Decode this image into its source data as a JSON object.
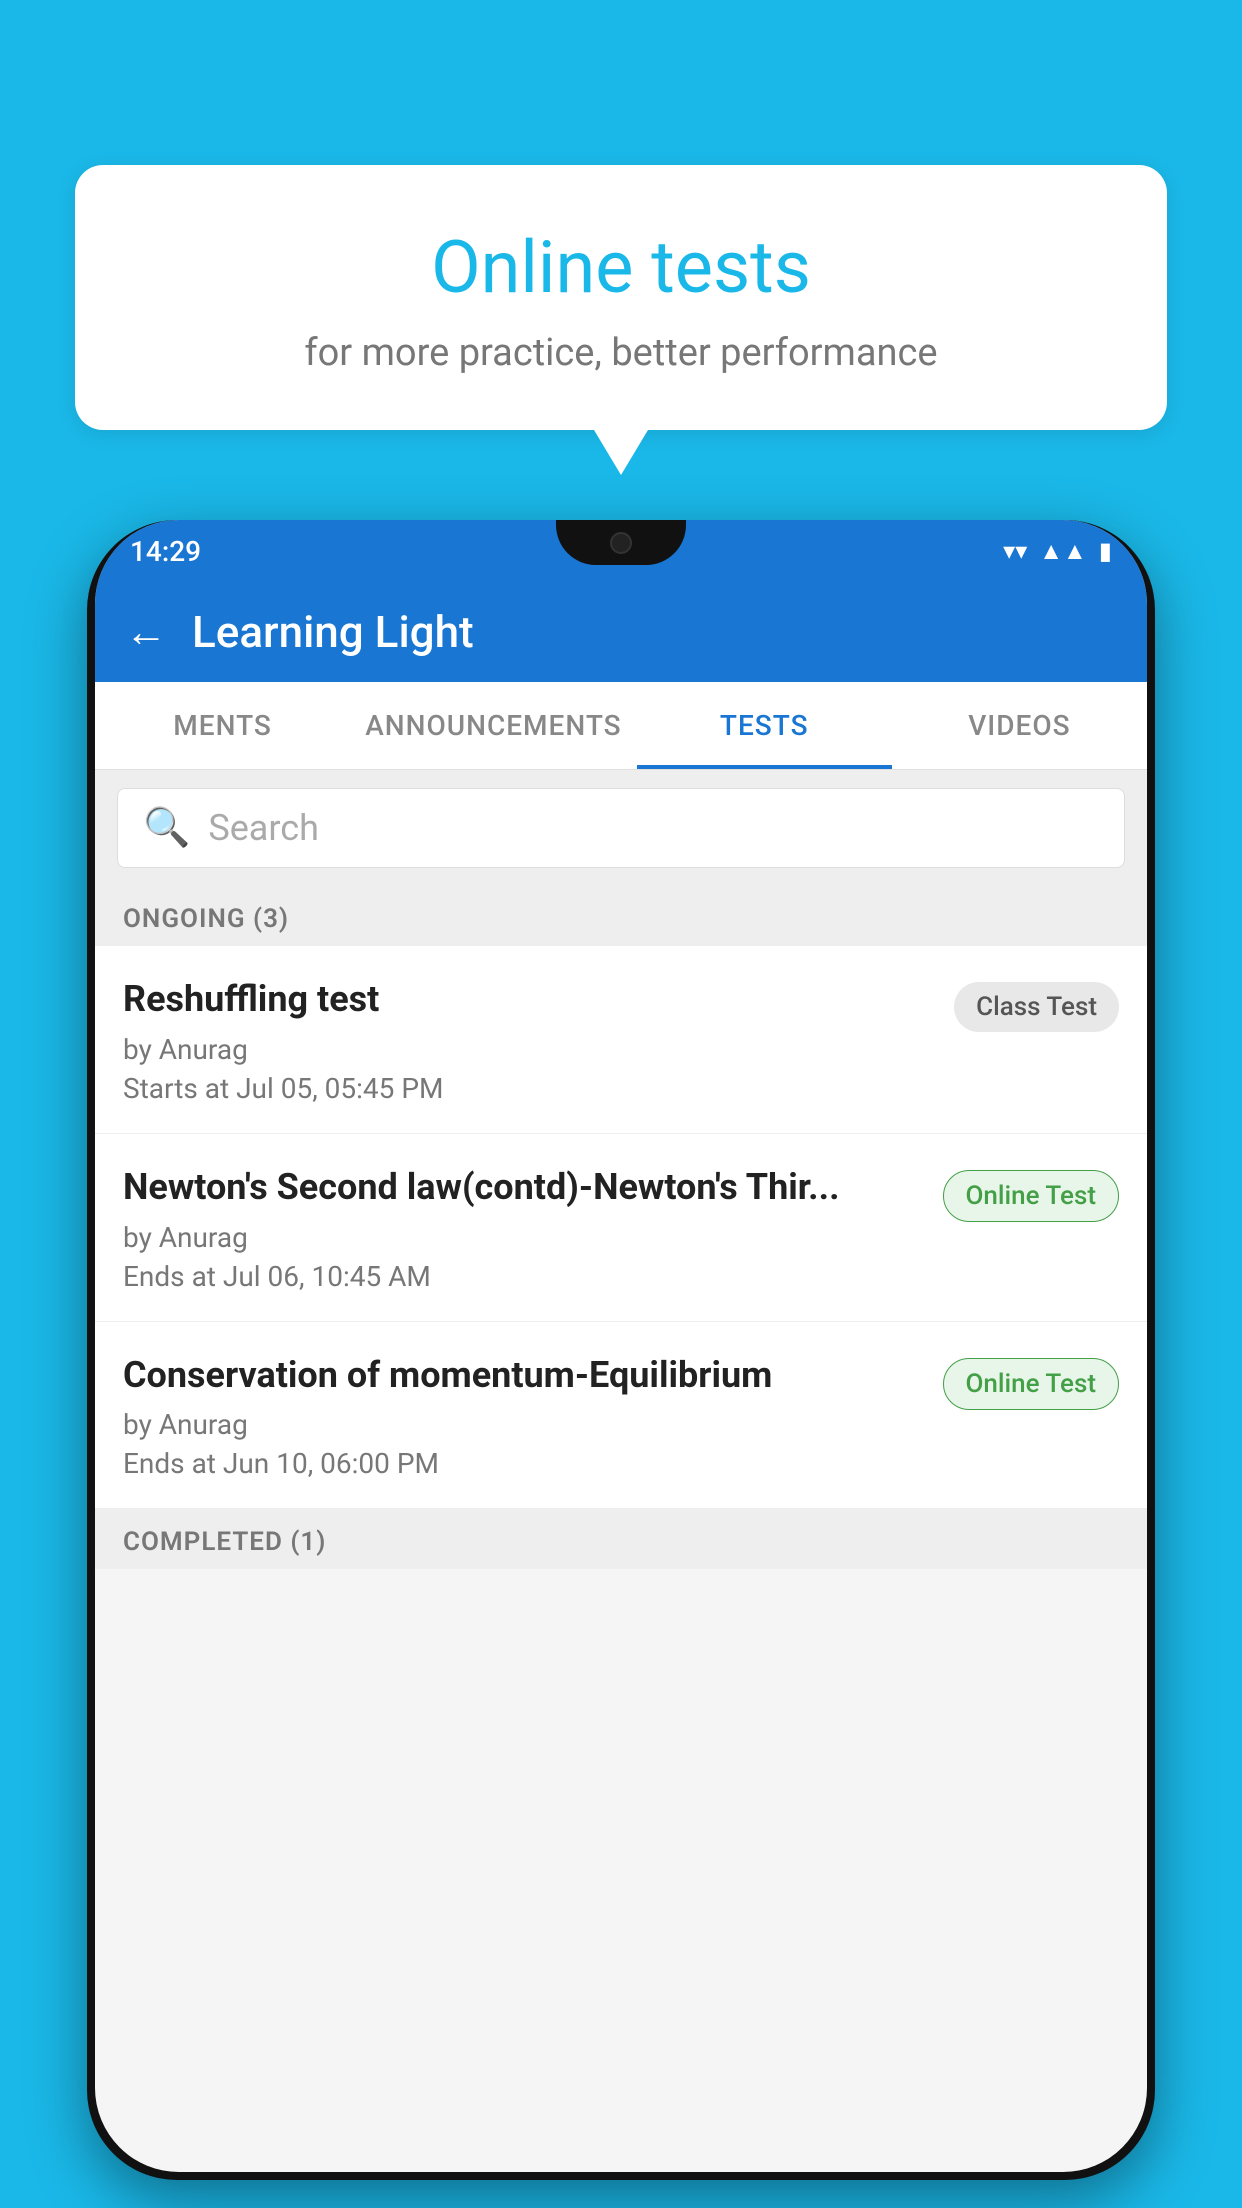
{
  "background_color": "#1ab8e8",
  "bubble": {
    "title": "Online tests",
    "subtitle": "for more practice, better performance"
  },
  "phone": {
    "status_bar": {
      "time": "14:29",
      "wifi_icon": "▼",
      "signal_icon": "▲",
      "battery_icon": "▮"
    },
    "app_bar": {
      "back_label": "←",
      "title": "Learning Light"
    },
    "tabs": [
      {
        "label": "MENTS",
        "active": false
      },
      {
        "label": "ANNOUNCEMENTS",
        "active": false
      },
      {
        "label": "TESTS",
        "active": true
      },
      {
        "label": "VIDEOS",
        "active": false
      }
    ],
    "search": {
      "placeholder": "Search"
    },
    "ongoing_section": {
      "label": "ONGOING (3)"
    },
    "tests": [
      {
        "name": "Reshuffling test",
        "author": "by Anurag",
        "time_label": "Starts at",
        "time": "Jul 05, 05:45 PM",
        "badge": "Class Test",
        "badge_type": "class"
      },
      {
        "name": "Newton's Second law(contd)-Newton's Thir...",
        "author": "by Anurag",
        "time_label": "Ends at",
        "time": "Jul 06, 10:45 AM",
        "badge": "Online Test",
        "badge_type": "online"
      },
      {
        "name": "Conservation of momentum-Equilibrium",
        "author": "by Anurag",
        "time_label": "Ends at",
        "time": "Jun 10, 06:00 PM",
        "badge": "Online Test",
        "badge_type": "online"
      }
    ],
    "completed_section": {
      "label": "COMPLETED (1)"
    }
  }
}
